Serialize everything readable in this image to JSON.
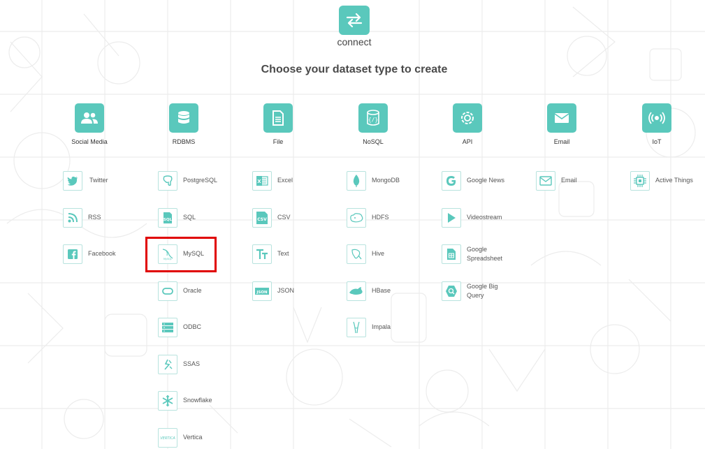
{
  "app": {
    "logo_label": "connect"
  },
  "page": {
    "title": "Choose your dataset type to create"
  },
  "colors": {
    "accent": "#5ac8bc",
    "icon_border": "#b8e3de",
    "highlight": "#e00000"
  },
  "categories": [
    {
      "label": "Social Media",
      "icon": "people-icon"
    },
    {
      "label": "RDBMS",
      "icon": "database-icon"
    },
    {
      "label": "File",
      "icon": "file-icon"
    },
    {
      "label": "NoSQL",
      "icon": "nosql-icon"
    },
    {
      "label": "API",
      "icon": "api-gear-icon"
    },
    {
      "label": "Email",
      "icon": "envelope-icon"
    },
    {
      "label": "IoT",
      "icon": "broadcast-icon"
    }
  ],
  "social": [
    {
      "label": "Twitter",
      "icon": "twitter-icon"
    },
    {
      "label": "RSS",
      "icon": "rss-icon"
    },
    {
      "label": "Facebook",
      "icon": "facebook-icon"
    }
  ],
  "rdbms": [
    {
      "label": "PostgreSQL",
      "icon": "postgresql-icon"
    },
    {
      "label": "SQL",
      "icon": "sql-icon"
    },
    {
      "label": "MySQL",
      "icon": "mysql-icon"
    },
    {
      "label": "Oracle",
      "icon": "oracle-icon"
    },
    {
      "label": "ODBC",
      "icon": "odbc-icon"
    },
    {
      "label": "SSAS",
      "icon": "ssas-icon"
    },
    {
      "label": "Snowflake",
      "icon": "snowflake-icon"
    },
    {
      "label": "Vertica",
      "icon": "vertica-icon"
    }
  ],
  "file": [
    {
      "label": "Excel",
      "icon": "excel-icon"
    },
    {
      "label": "CSV",
      "icon": "csv-icon"
    },
    {
      "label": "Text",
      "icon": "text-icon"
    },
    {
      "label": "JSON",
      "icon": "json-icon"
    }
  ],
  "nosql": [
    {
      "label": "MongoDB",
      "icon": "mongodb-icon"
    },
    {
      "label": "HDFS",
      "icon": "hdfs-icon"
    },
    {
      "label": "Hive",
      "icon": "hive-icon"
    },
    {
      "label": "HBase",
      "icon": "hbase-icon"
    },
    {
      "label": "Impala",
      "icon": "impala-icon"
    }
  ],
  "api": [
    {
      "label": "Google News",
      "icon": "google-icon"
    },
    {
      "label": "Videostream",
      "icon": "play-icon"
    },
    {
      "label": "Google Spreadsheet",
      "line1": "Google",
      "line2": "Spreadsheet",
      "icon": "spreadsheet-icon"
    },
    {
      "label": "Google Big Query",
      "line1": "Google Big",
      "line2": "Query",
      "icon": "bigquery-icon"
    }
  ],
  "email": [
    {
      "label": "Email",
      "icon": "envelope-icon"
    }
  ],
  "iot": [
    {
      "label": "Active Things",
      "icon": "chip-icon"
    }
  ],
  "selected_item": "MySQL"
}
